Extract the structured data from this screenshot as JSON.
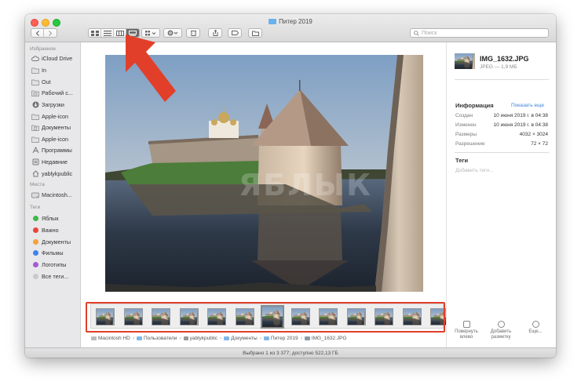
{
  "window": {
    "title": "Питер 2019"
  },
  "toolbar": {
    "search_placeholder": "Поиск",
    "view_modes": [
      "icon-view",
      "list-view",
      "column-view",
      "gallery-view"
    ],
    "active_view": "gallery-view"
  },
  "sidebar": {
    "favorites_header": "Избранное",
    "favorites": [
      {
        "label": "iCloud Drive",
        "icon": "cloud-icon"
      },
      {
        "label": "In",
        "icon": "folder-icon"
      },
      {
        "label": "Out",
        "icon": "folder-icon"
      },
      {
        "label": "Рабочий с...",
        "icon": "desktop-folder-icon"
      },
      {
        "label": "Загрузки",
        "icon": "downloads-icon"
      },
      {
        "label": "Apple-icon",
        "icon": "folder-icon"
      },
      {
        "label": "Документы",
        "icon": "documents-folder-icon"
      },
      {
        "label": "Apple-icon",
        "icon": "folder-icon"
      },
      {
        "label": "Программы",
        "icon": "applications-icon"
      },
      {
        "label": "Недавние",
        "icon": "recents-icon"
      },
      {
        "label": "yablykpublic",
        "icon": "home-icon"
      }
    ],
    "locations_header": "Места",
    "locations": [
      {
        "label": "Macintosh...",
        "icon": "disk-icon"
      }
    ],
    "tags_header": "Теги",
    "tags": [
      {
        "label": "Яблык",
        "color": "#3cb94a"
      },
      {
        "label": "Важно",
        "color": "#e8453c"
      },
      {
        "label": "Документы",
        "color": "#f1a33a"
      },
      {
        "label": "Фильмы",
        "color": "#3f82ee"
      },
      {
        "label": "Логотипы",
        "color": "#a65ad4"
      },
      {
        "label": "Все теги...",
        "color": "#c9c9c9"
      }
    ]
  },
  "content": {
    "watermark": "ЯБЛЫК",
    "thumbnail_count": 13,
    "selected_thumbnail": 6
  },
  "info": {
    "file_name": "IMG_1632.JPG",
    "file_meta": "JPEG — 1,9 МБ",
    "info_header": "Информация",
    "show_more": "Показать еще",
    "rows": [
      {
        "label": "Создан",
        "value": "10 июня 2019 г. в 04:38"
      },
      {
        "label": "Изменен",
        "value": "10 июня 2019 г. в 04:38"
      },
      {
        "label": "Размеры",
        "value": "4032 × 3024"
      },
      {
        "label": "Разрешение",
        "value": "72 × 72"
      }
    ],
    "tags_header": "Теги",
    "add_tags": "Добавить теги...",
    "actions": [
      {
        "label1": "Повернуть",
        "label2": "влево"
      },
      {
        "label1": "Добавить",
        "label2": "разметку"
      },
      {
        "label1": "Еще...",
        "label2": ""
      }
    ]
  },
  "pathbar": [
    "Macintosh HD",
    "Пользователи",
    "yablykpublic",
    "Документы",
    "Питер 2019",
    "IMG_1632.JPG"
  ],
  "status": "Выбрано 1 из 3 377; доступно 522,13 ГБ"
}
